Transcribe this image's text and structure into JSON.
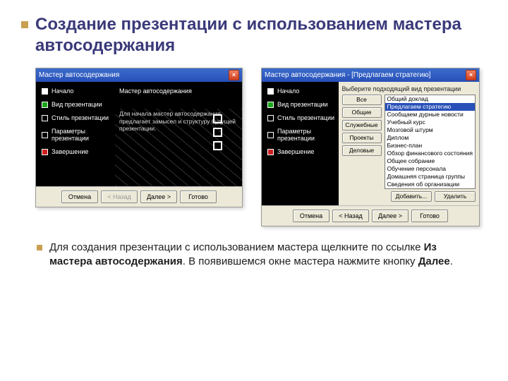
{
  "title": "Создание презентации с использованием мастера автосодержания",
  "left_window": {
    "titlebar": "Мастер автосодержания",
    "nav": [
      {
        "label": "Начало",
        "color": "white"
      },
      {
        "label": "Вид презентации",
        "color": "green"
      },
      {
        "label": "Стиль презентации",
        "color": "none"
      },
      {
        "label": "Параметры презентации",
        "color": "none"
      },
      {
        "label": "Завершение",
        "color": "red"
      }
    ],
    "panel_heading": "Мастер автосодержания",
    "panel_text": "Для начала мастер автосодержания предлагает замысел и структуру будущей презентации."
  },
  "right_window": {
    "titlebar": "Мастер автосодержания - [Предлагаем стратегию]",
    "nav": [
      {
        "label": "Начало",
        "color": "white"
      },
      {
        "label": "Вид презентации",
        "color": "green"
      },
      {
        "label": "Стиль презентации",
        "color": "none"
      },
      {
        "label": "Параметры презентации",
        "color": "none"
      },
      {
        "label": "Завершение",
        "color": "red"
      }
    ],
    "prompt": "Выберите подходящий вид презентации",
    "categories": [
      "Все",
      "Общие",
      "Служебные",
      "Проекты",
      "Деловые"
    ],
    "list": [
      "Общий доклад",
      "Предлагаем стратегию",
      "Сообщаем дурные новости",
      "Учебный курс",
      "Мозговой штурм",
      "Диплом",
      "Бизнес-план",
      "Обзор финансового состояния",
      "Общее собрание",
      "Обучение персонала",
      "Домашняя страница группы",
      "Сведения об организации"
    ],
    "selected_index": 1,
    "add_label": "Добавить...",
    "del_label": "Удалить"
  },
  "footer_buttons": {
    "cancel": "Отмена",
    "back": "< Назад",
    "next": "Далее >",
    "finish": "Готово"
  },
  "body": {
    "p1": "Для создания презентации с использованием мастера щелкните по ссылке ",
    "b1": "Из мастера автосодержания",
    "p2": ". В появившемся окне мастера нажмите кнопку ",
    "b2": "Далее",
    "p3": "."
  }
}
